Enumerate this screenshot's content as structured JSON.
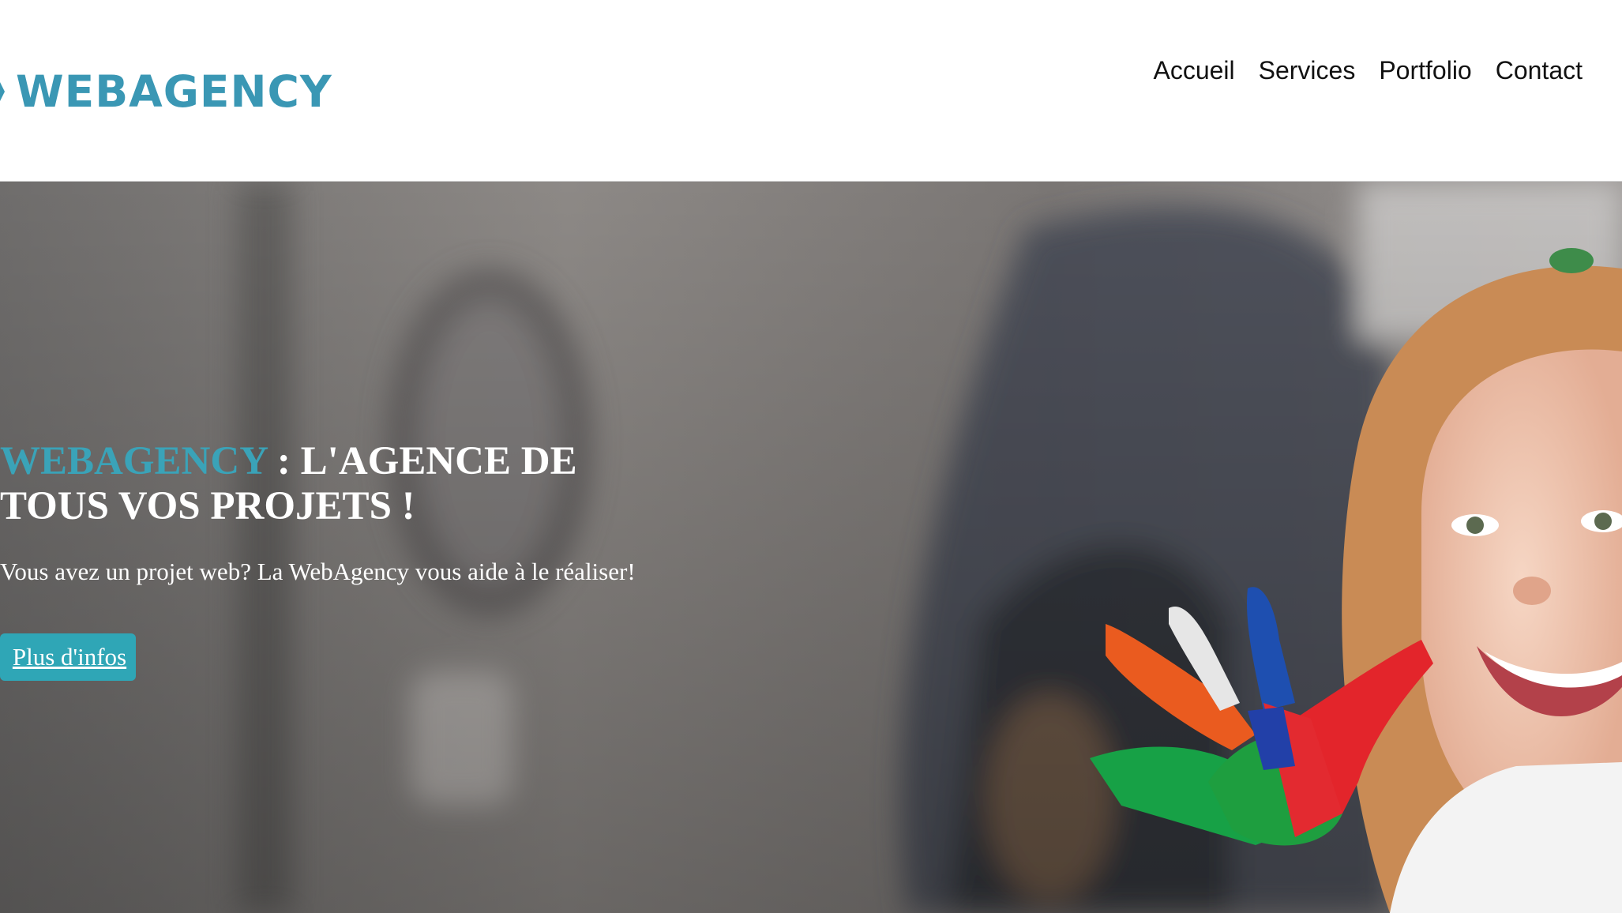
{
  "header": {
    "logo_text": "WEBAGENCY",
    "nav": [
      {
        "label": "Accueil"
      },
      {
        "label": "Services"
      },
      {
        "label": "Portfolio"
      },
      {
        "label": "Contact"
      }
    ]
  },
  "hero": {
    "title_brand": "WEBAGENCY",
    "title_rest": " : L'AGENCE DE TOUS VOS PROJETS !",
    "subtitle": "Vous avez un projet web? La WebAgency vous aide à le réaliser!",
    "button_label": "Plus d'infos"
  },
  "colors": {
    "brand": "#3a97b4",
    "button": "#2fa6b6",
    "nav_text": "#111111",
    "hero_text": "#ffffff"
  },
  "icons": {
    "logo_mark": "logo-mark-icon"
  }
}
